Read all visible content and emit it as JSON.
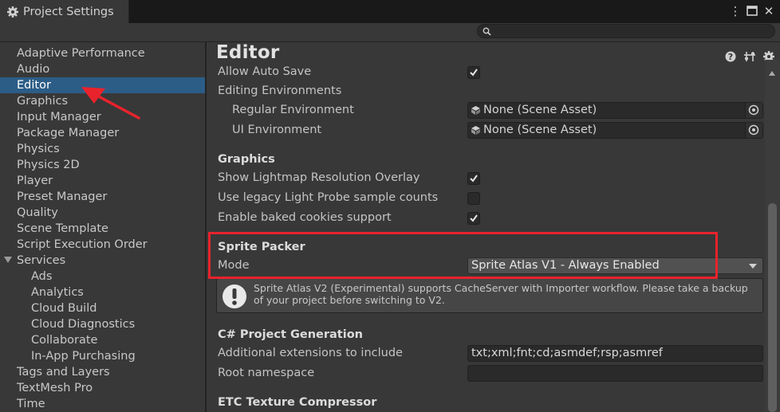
{
  "window": {
    "title": "Project Settings",
    "search": {
      "placeholder": "",
      "value": ""
    }
  },
  "sidebar": {
    "items": [
      {
        "label": "Adaptive Performance"
      },
      {
        "label": "Audio"
      },
      {
        "label": "Editor",
        "selected": true
      },
      {
        "label": "Graphics"
      },
      {
        "label": "Input Manager"
      },
      {
        "label": "Package Manager"
      },
      {
        "label": "Physics"
      },
      {
        "label": "Physics 2D"
      },
      {
        "label": "Player"
      },
      {
        "label": "Preset Manager"
      },
      {
        "label": "Quality"
      },
      {
        "label": "Scene Template"
      },
      {
        "label": "Script Execution Order"
      },
      {
        "label": "Services",
        "expanded": true
      },
      {
        "label": "Ads",
        "child": true
      },
      {
        "label": "Analytics",
        "child": true
      },
      {
        "label": "Cloud Build",
        "child": true
      },
      {
        "label": "Cloud Diagnostics",
        "child": true
      },
      {
        "label": "Collaborate",
        "child": true
      },
      {
        "label": "In-App Purchasing",
        "child": true
      },
      {
        "label": "Tags and Layers"
      },
      {
        "label": "TextMesh Pro"
      },
      {
        "label": "Time"
      }
    ]
  },
  "editor": {
    "title": "Editor",
    "allow_auto_save": {
      "label": "Allow Auto Save",
      "checked": true
    },
    "editing_environments": "Editing Environments",
    "regular_environment": {
      "label": "Regular Environment",
      "value": "None (Scene Asset)"
    },
    "ui_environment": {
      "label": "UI Environment",
      "value": "None (Scene Asset)"
    },
    "graphics": {
      "header": "Graphics",
      "lightmap_overlay": {
        "label": "Show Lightmap Resolution Overlay",
        "checked": true
      },
      "legacy_light_probe": {
        "label": "Use legacy Light Probe sample counts",
        "checked": false
      },
      "baked_cookies": {
        "label": "Enable baked cookies support",
        "checked": true
      }
    },
    "sprite_packer": {
      "header": "Sprite Packer",
      "mode_label": "Mode",
      "mode_value": "Sprite Atlas V1 - Always Enabled",
      "help": "Sprite Atlas V2 (Experimental) supports CacheServer with Importer workflow. Please take a backup of your project before switching to V2."
    },
    "csharp": {
      "header": "C# Project Generation",
      "extensions_label": "Additional extensions to include",
      "extensions_value": "txt;xml;fnt;cd;asmdef;rsp;asmref",
      "root_namespace_label": "Root namespace",
      "root_namespace_value": ""
    },
    "etc": {
      "header": "ETC Texture Compressor"
    }
  },
  "colors": {
    "selection": "#2c5d87",
    "highlight": "#e8232c",
    "panel": "#383838"
  }
}
